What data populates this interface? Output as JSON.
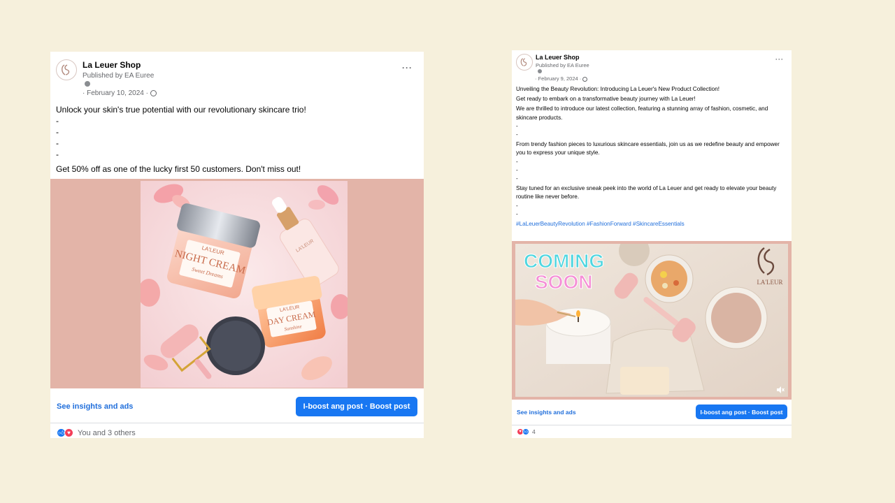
{
  "colors": {
    "background": "#f6f0dc",
    "accent_blue": "#1877f2",
    "link_blue": "#216fdb",
    "media_frame_pink": "#e3b4a8",
    "love_red": "#f33e58"
  },
  "posts": [
    {
      "page_name": "La Leuer Shop",
      "published_by": "Published by EA Euree",
      "date": "· February 10, 2024 ·",
      "privacy_icon": "globe-icon",
      "more_icon": "more-icon",
      "more_label": "···",
      "body": {
        "headline": "Unlock your skin's true potential with our revolutionary skincare trio!",
        "dash_1": "-",
        "dash_2": "-",
        "dash_3": "-",
        "dash_4": "-",
        "offer": "Get 50% off as one of the lucky first 50 customers. Don't miss out!"
      },
      "image": {
        "brand": "LA'LEUR",
        "jar_1_label": "NIGHT CREAM",
        "jar_1_sub": "Sweet Dreams",
        "jar_2_label": "DAY CREAM",
        "jar_2_sub": "Sunshine",
        "bottle_label": "LA'LEUR"
      },
      "insights_label": "See insights and ads",
      "boost_label": "I-boost ang post · Boost post",
      "reactions": {
        "icons": [
          "like-icon",
          "love-icon"
        ],
        "text": "You and 3 others"
      }
    },
    {
      "page_name": "La Leuer Shop",
      "published_by": "Published by EA Euree",
      "date": "· February 9, 2024 ·",
      "privacy_icon": "globe-icon",
      "more_icon": "more-icon",
      "more_label": "···",
      "body": {
        "line_1": "Unveiling the Beauty Revolution: Introducing La Leuer's New Product Collection!",
        "line_2": "Get ready to embark on a transformative beauty journey with La Leuer!",
        "line_3": "We are thrilled to introduce our latest collection, featuring a stunning array of fashion, cosmetic, and skincare products.",
        "dash_1": "-",
        "dash_2": "-",
        "line_4": "From trendy fashion pieces to luxurious skincare essentials, join us as we redefine beauty and empower you to express your unique style.",
        "dash_3": "-",
        "dash_4": "-",
        "dash_5": "-",
        "line_5": "Stay tuned for an exclusive sneak peek into the world of La Leuer and get ready to elevate your beauty routine like never before.",
        "dash_6": "-",
        "dash_7": "-",
        "hashtags": "#LaLeuerBeautyRevolution #FashionForward #SkincareEssentials"
      },
      "video": {
        "coming": "COMING",
        "soon": "SOON",
        "brand": "LA'LEUR",
        "mute_icon": "mute-icon"
      },
      "insights_label": "See insights and ads",
      "boost_label": "I-boost ang post · Boost post",
      "reactions": {
        "icons": [
          "love-icon",
          "like-icon"
        ],
        "text": "4"
      }
    }
  ]
}
